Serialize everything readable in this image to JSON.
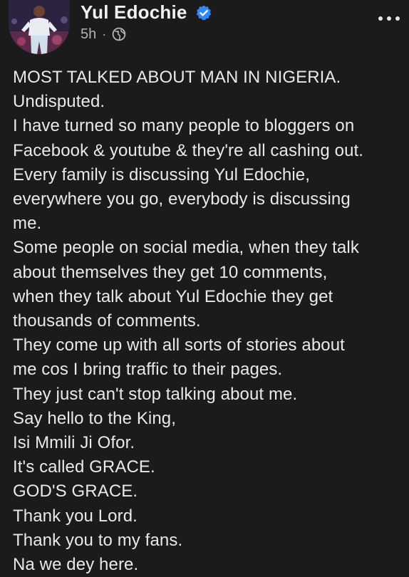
{
  "post": {
    "author": "Yul Edochie",
    "time": "5h",
    "separator": "·",
    "visibility_icon": "globe-icon",
    "verified_icon": "verified-badge-icon",
    "more_icon": "more-options-icon",
    "colors": {
      "background": "#1b1b1c",
      "text": "#e8e9ed",
      "secondary_text": "#b0b3b8",
      "verified": "#2d88ff"
    },
    "lines": [
      "MOST TALKED ABOUT MAN IN NIGERIA.",
      "Undisputed.",
      "I have turned so many people to bloggers on",
      "Facebook & youtube & they're all cashing out.",
      "Every family is discussing Yul Edochie,",
      "everywhere you go, everybody is discussing",
      "me.",
      "Some people on social media, when they talk",
      "about themselves they get 10 comments,",
      "when they talk about Yul Edochie they get",
      "thousands of comments.",
      "They come up with all sorts of stories about",
      "me cos I bring traffic to their pages.",
      "They just can't stop talking about me.",
      "Say hello to the King,",
      "Isi Mmili Ji Ofor.",
      "It's called GRACE.",
      "GOD'S GRACE.",
      "Thank you Lord.",
      "Thank you to my fans.",
      "Na we dey here."
    ]
  }
}
